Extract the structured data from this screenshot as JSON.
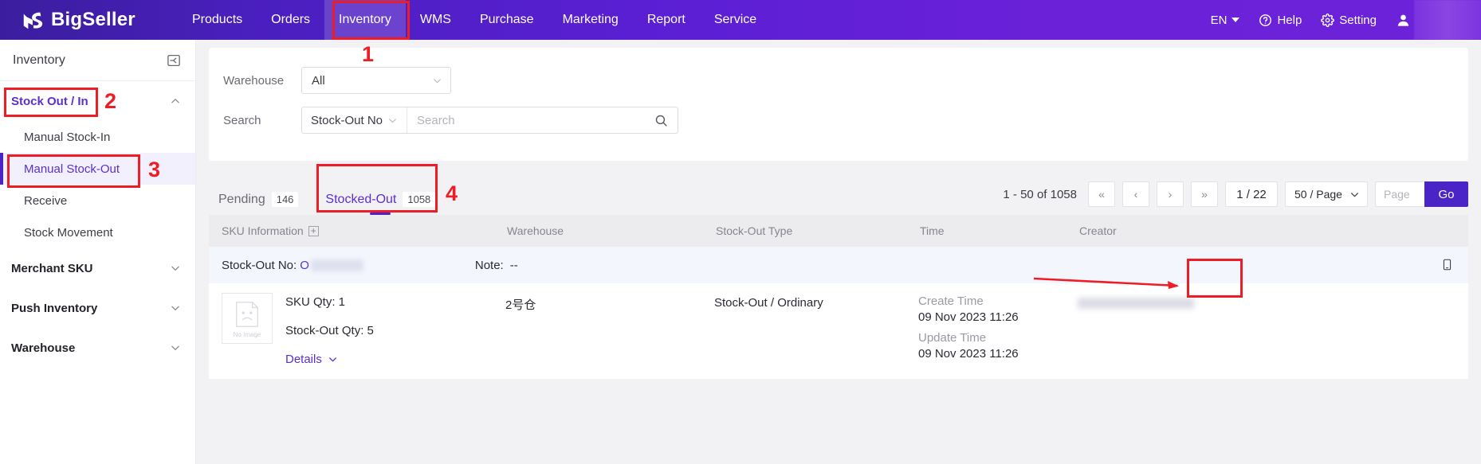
{
  "topnav": {
    "brand": "BigSeller",
    "items": [
      {
        "label": "Products",
        "active": false
      },
      {
        "label": "Orders",
        "active": false
      },
      {
        "label": "Inventory",
        "active": true
      },
      {
        "label": "WMS",
        "active": false
      },
      {
        "label": "Purchase",
        "active": false
      },
      {
        "label": "Marketing",
        "active": false
      },
      {
        "label": "Report",
        "active": false
      },
      {
        "label": "Service",
        "active": false
      }
    ],
    "language": "EN",
    "help": "Help",
    "setting": "Setting"
  },
  "sidebar": {
    "title": "Inventory",
    "groups": [
      {
        "label": "Stock Out / In",
        "expanded": true,
        "children": [
          {
            "label": "Manual Stock-In",
            "selected": false
          },
          {
            "label": "Manual Stock-Out",
            "selected": true
          },
          {
            "label": "Receive",
            "selected": false
          },
          {
            "label": "Stock Movement",
            "selected": false
          }
        ]
      },
      {
        "label": "Merchant SKU",
        "expanded": false,
        "children": []
      },
      {
        "label": "Push Inventory",
        "expanded": false,
        "children": []
      },
      {
        "label": "Warehouse",
        "expanded": false,
        "children": []
      }
    ]
  },
  "filters": {
    "warehouse_label": "Warehouse",
    "warehouse_value": "All",
    "search_label": "Search",
    "search_type": "Stock-Out No",
    "search_placeholder": "Search",
    "search_value": ""
  },
  "tabs": [
    {
      "label": "Pending",
      "count": "146",
      "active": false
    },
    {
      "label": "Stocked-Out",
      "count": "1058",
      "active": true
    }
  ],
  "pagination": {
    "range_text": "1 - 50 of 1058",
    "first": "«",
    "prev": "‹",
    "next": "›",
    "last": "»",
    "page_display": "1 / 22",
    "page_size": "50 / Page",
    "page_placeholder": "Page",
    "go_label": "Go"
  },
  "table": {
    "columns": [
      "SKU Information",
      "Warehouse",
      "Stock-Out Type",
      "Time",
      "Creator"
    ],
    "row": {
      "stock_out_no_label": "Stock-Out No:",
      "stock_out_no_prefix": "O",
      "note_label": "Note:",
      "note_value": "--",
      "no_image_label": "No Image",
      "sku_qty": "SKU Qty: 1",
      "stock_out_qty": "Stock-Out Qty: 5",
      "details_label": "Details",
      "warehouse": "2号仓",
      "stock_out_type": "Stock-Out / Ordinary",
      "create_time_label": "Create Time",
      "create_time_value": "09 Nov 2023 11:26",
      "update_time_label": "Update Time",
      "update_time_value": "09 Nov 2023 11:26"
    }
  },
  "annotations": {
    "one": "1",
    "two": "2",
    "three": "3",
    "four": "4"
  }
}
